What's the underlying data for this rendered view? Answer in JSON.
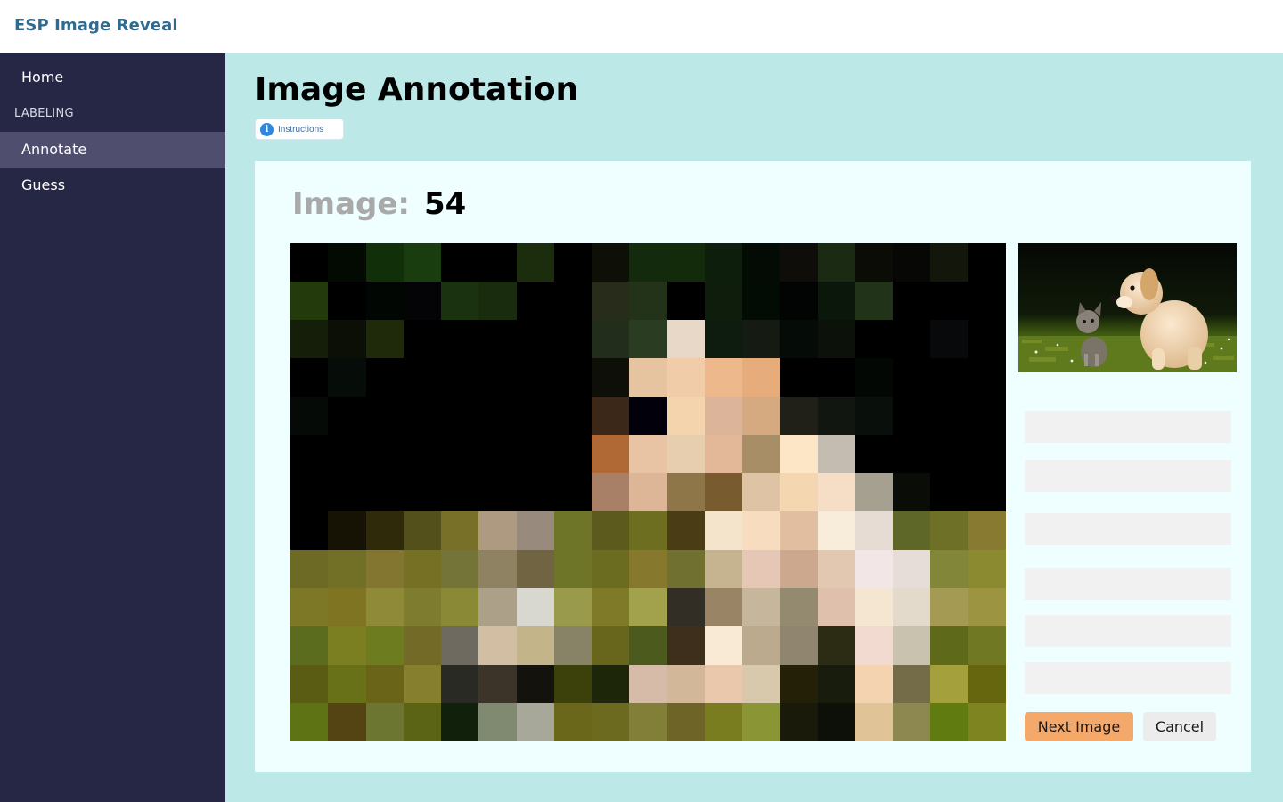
{
  "app": {
    "title": "ESP Image Reveal"
  },
  "sidebar": {
    "items": [
      {
        "label": "Home"
      },
      {
        "label": "Annotate"
      },
      {
        "label": "Guess"
      }
    ],
    "section_label": "LABELING",
    "active_item": "Annotate"
  },
  "main": {
    "title": "Image Annotation",
    "instructions_label": "Instructions",
    "image_label": "Image:",
    "image_number": "54"
  },
  "form": {
    "fields": [
      {
        "value": "",
        "placeholder": ""
      },
      {
        "value": "",
        "placeholder": ""
      },
      {
        "value": "",
        "placeholder": ""
      },
      {
        "value": "",
        "placeholder": ""
      },
      {
        "value": "",
        "placeholder": ""
      },
      {
        "value": "",
        "placeholder": ""
      }
    ],
    "next_label": "Next Image",
    "cancel_label": "Cancel"
  },
  "pixel_image": {
    "rows": [
      [
        "#000000",
        "#020a02",
        "#11300a",
        "#1a3d0f",
        "#000000",
        "#000000",
        "#1c2d0e",
        "#000000",
        "#0e0f07",
        "#132a0c",
        "#132b0b",
        "#0e1e0c",
        "#030b04",
        "#0e0d0a",
        "#1b2a12",
        "#0c0c06",
        "#070806",
        "#13160b",
        "#000000"
      ],
      [
        "#223a0c",
        "#000000",
        "#010602",
        "#040407",
        "#1a3210",
        "#1a2c0e",
        "#000000",
        "#000000",
        "#282c1b",
        "#22331a",
        "#000000",
        "#0f1e0c",
        "#030c04",
        "#010402",
        "#0c170c",
        "#213319",
        "#000000",
        "#000000",
        "#000000"
      ],
      [
        "#141e08",
        "#0b0f06",
        "#1f2a0b",
        "#000000",
        "#000000",
        "#000000",
        "#000000",
        "#000000",
        "#222e1b",
        "#2a3c22",
        "#e8d8c8",
        "#0d1c0e",
        "#151b13",
        "#050c08",
        "#0c110a",
        "#000000",
        "#000000",
        "#07090a",
        "#000000"
      ],
      [
        "#000000",
        "#060c08",
        "#000000",
        "#000000",
        "#000000",
        "#000000",
        "#000000",
        "#000000",
        "#0e0f08",
        "#e6c4a0",
        "#f0cca8",
        "#ecb88c",
        "#e6ac7c",
        "#000000",
        "#000000",
        "#020704",
        "#000000",
        "#000000",
        "#000000"
      ],
      [
        "#050a06",
        "#000000",
        "#000000",
        "#000000",
        "#000000",
        "#000000",
        "#000000",
        "#000000",
        "#3c2818",
        "#02000a",
        "#f4d4ac",
        "#dcb49a",
        "#d6aa80",
        "#202018",
        "#111710",
        "#09100c",
        "#000000",
        "#000000",
        "#000000"
      ],
      [
        "#000000",
        "#000000",
        "#000000",
        "#000000",
        "#000000",
        "#000000",
        "#000000",
        "#000000",
        "#b06834",
        "#e8c4a4",
        "#e6ceae",
        "#e2b898",
        "#a88e66",
        "#fce6c6",
        "#c4bcb0",
        "#000000",
        "#000000",
        "#000000",
        "#000000"
      ],
      [
        "#000000",
        "#000000",
        "#000000",
        "#000000",
        "#000000",
        "#000000",
        "#000000",
        "#000000",
        "#a88068",
        "#dcb696",
        "#8e7648",
        "#785c30",
        "#dec4a4",
        "#f4d6b0",
        "#f6dec6",
        "#a6a090",
        "#0a0c08",
        "#000000",
        "#000000"
      ],
      [
        "#000000",
        "#161204",
        "#2e2a0a",
        "#54501c",
        "#787028",
        "#ae9a80",
        "#988a7c",
        "#6e7428",
        "#5c5a1c",
        "#6e6e20",
        "#4a3c14",
        "#f4e4cc",
        "#f8dcc0",
        "#e2bea0",
        "#f8ecda",
        "#e6dcd4",
        "#5e6628",
        "#6e7028",
        "#887a30"
      ],
      [
        "#6c6a24",
        "#727026",
        "#827630",
        "#767024",
        "#747438",
        "#8e8262",
        "#706442",
        "#6e7428",
        "#6c6c20",
        "#86782c",
        "#707030",
        "#c6b490",
        "#e6c6b4",
        "#cca88e",
        "#e2c8b0",
        "#f2e6e6",
        "#e6dcd8",
        "#828638",
        "#8c8a30"
      ],
      [
        "#7c7826",
        "#7e7422",
        "#8e8a38",
        "#7e7c2e",
        "#8a8a36",
        "#aca088",
        "#d8d8d0",
        "#9a9a4c",
        "#7e7a28",
        "#a2a24c",
        "#322e26",
        "#9a8466",
        "#c6b69c",
        "#948a70",
        "#dec0ac",
        "#f4e6d0",
        "#e4dacc",
        "#a49a54",
        "#9c9440"
      ],
      [
        "#5c6c1e",
        "#7c7e22",
        "#6c7c1e",
        "#726a26",
        "#6e6a60",
        "#d2bea2",
        "#c4b48a",
        "#888266",
        "#68661c",
        "#4c5a1e",
        "#3e2e1c",
        "#f8ead4",
        "#bcaa8e",
        "#908670",
        "#2c2c14",
        "#f2dad0",
        "#c8c2ae",
        "#5e6a1a",
        "#707824"
      ],
      [
        "#5a5c14",
        "#687018",
        "#6a6418",
        "#86802e",
        "#2a2a24",
        "#3c3428",
        "#14120c",
        "#3c400a",
        "#1e260a",
        "#d6bca8",
        "#d2b898",
        "#eac8ac",
        "#d8c8ac",
        "#242008",
        "#181c0c",
        "#f4d4b0",
        "#746c48",
        "#a4a03c",
        "#66660e"
      ],
      [
        "#5e7414",
        "#544414",
        "#6c7630",
        "#5a6414",
        "#10200a",
        "#808a70",
        "#a8a89a",
        "#6a661a",
        "#6c6a1e",
        "#828038",
        "#6e6428",
        "#7a7c20",
        "#8a9636",
        "#1a1a0a",
        "#0c1008",
        "#e0c498",
        "#8c8850",
        "#607c10",
        "#7e8420"
      ]
    ]
  }
}
